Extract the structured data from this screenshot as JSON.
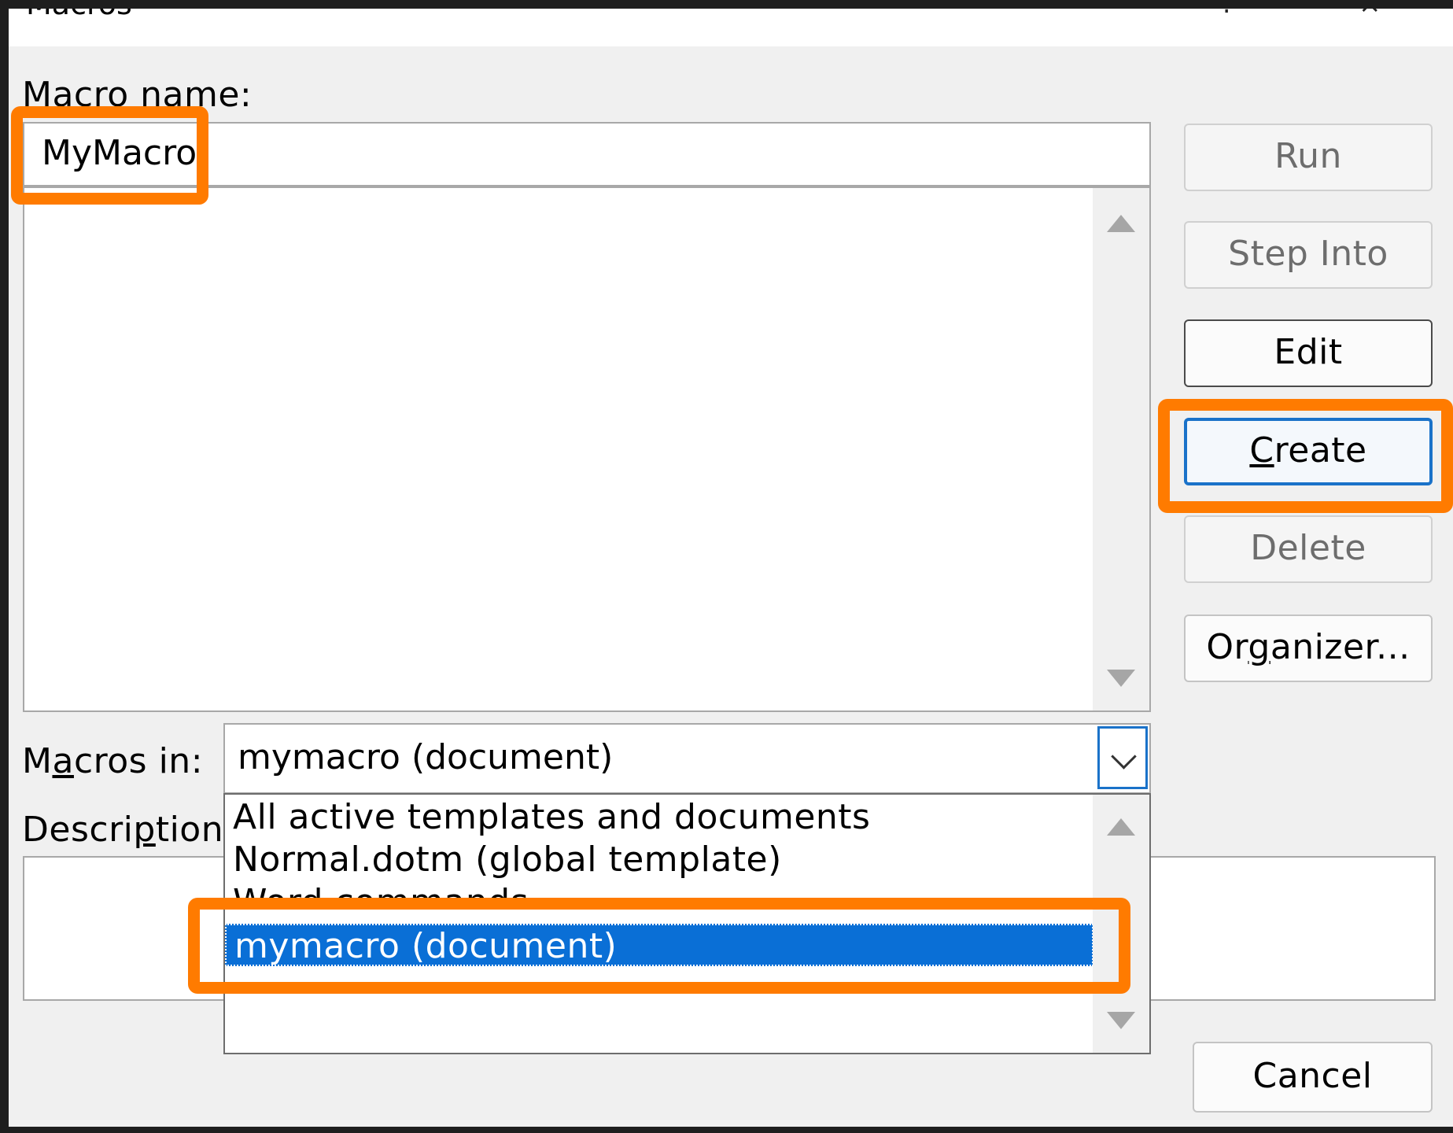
{
  "window": {
    "title": "Macros",
    "controls": {
      "help": "?",
      "close": "×"
    }
  },
  "labels": {
    "macro_name": "Macro name:",
    "macros_in_prefix": "M",
    "macros_in_accel": "a",
    "macros_in_suffix": "cros in:",
    "description_prefix": "Descri",
    "description_accel": "p",
    "description_suffix": "tion:"
  },
  "macro_name_value": "MyMacro",
  "buttons": {
    "run": "Run",
    "step_into": "Step Into",
    "edit": "Edit",
    "create_accel": "C",
    "create_rest": "reate",
    "delete": "Delete",
    "organizer_prefix": "Or",
    "organizer_accel": "g",
    "organizer_suffix": "anizer...",
    "cancel": "Cancel"
  },
  "macros_in": {
    "selected": "mymacro (document)",
    "options": [
      "All active templates and documents",
      "Normal.dotm (global template)",
      "Word commands",
      "mymacro (document)"
    ]
  },
  "colors": {
    "highlight_annotation": "#ff7b00",
    "selection": "#0a6fd6",
    "focus_border": "#1a72c9"
  }
}
